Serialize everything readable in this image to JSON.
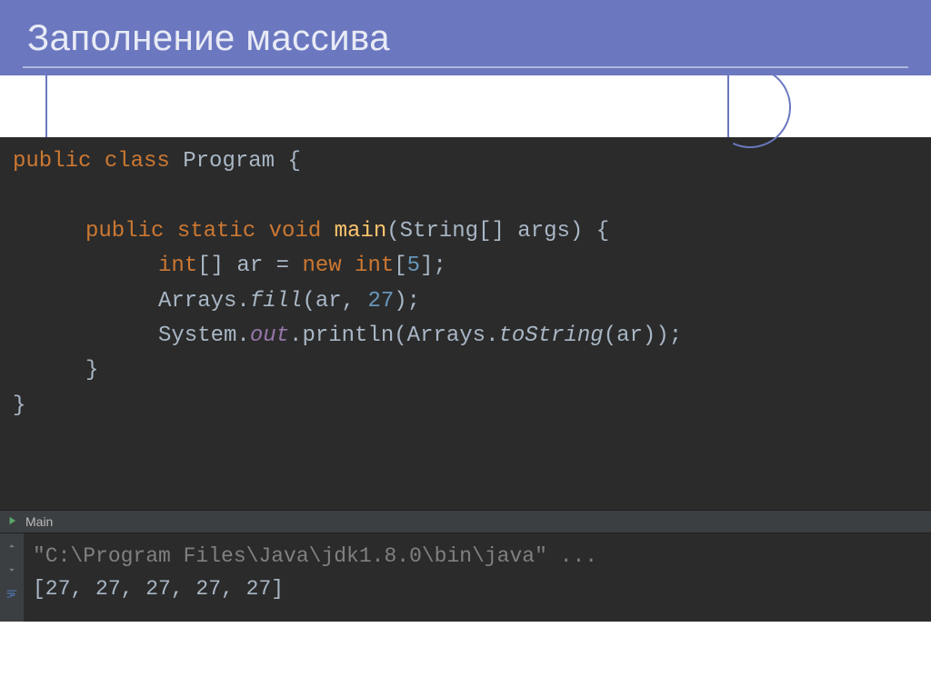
{
  "slide": {
    "title": "Заполнение массива"
  },
  "code": {
    "l1_a": "public class",
    "l1_b": " Program {",
    "l2_a": "public static void ",
    "l2_b": "main",
    "l2_c": "(String[] args) {",
    "l3_a": "int",
    "l3_b": "[] ar = ",
    "l3_c": "new int",
    "l3_d": "[",
    "l3_e": "5",
    "l3_f": "];",
    "l4_a": "Arrays.",
    "l4_b": "fill",
    "l4_c": "(ar, ",
    "l4_d": "27",
    "l4_e": ");",
    "l5_a": "System.",
    "l5_b": "out",
    "l5_c": ".println(Arrays.",
    "l5_d": "toString",
    "l5_e": "(ar));",
    "l6": "}",
    "l7": "}"
  },
  "runconf": {
    "label": "Main"
  },
  "console": {
    "cmd": "\"C:\\Program Files\\Java\\jdk1.8.0\\bin\\java\" ...",
    "output": "[27, 27, 27, 27, 27]"
  }
}
